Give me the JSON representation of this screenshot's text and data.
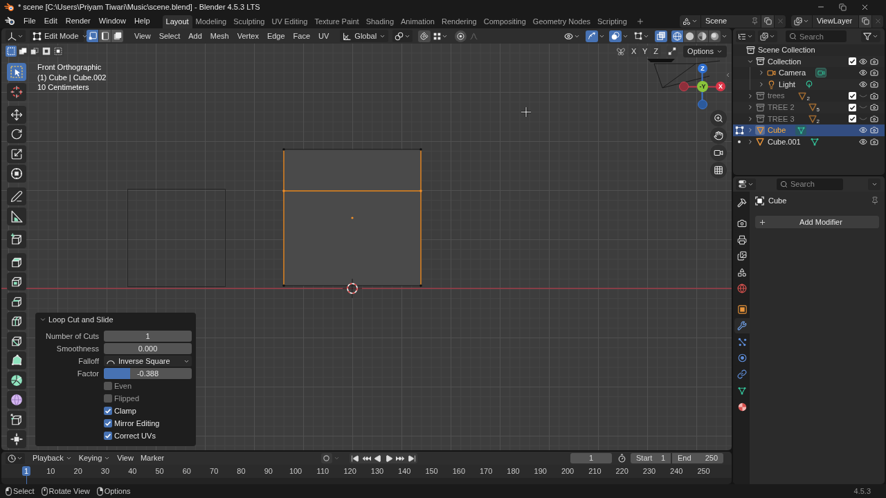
{
  "title_bar": {
    "title": "* scene [C:\\Users\\Priyam Tiwari\\Music\\scene.blend] - Blender 4.5.3 LTS"
  },
  "top_bar": {
    "menus": [
      "File",
      "Edit",
      "Render",
      "Window",
      "Help"
    ],
    "workspaces": [
      {
        "label": "Layout",
        "selected": true
      },
      {
        "label": "Modeling",
        "selected": false
      },
      {
        "label": "Sculpting",
        "selected": false
      },
      {
        "label": "UV Editing",
        "selected": false
      },
      {
        "label": "Texture Paint",
        "selected": false
      },
      {
        "label": "Shading",
        "selected": false
      },
      {
        "label": "Animation",
        "selected": false
      },
      {
        "label": "Rendering",
        "selected": false
      },
      {
        "label": "Compositing",
        "selected": false
      },
      {
        "label": "Geometry Nodes",
        "selected": false
      },
      {
        "label": "Scripting",
        "selected": false
      }
    ],
    "scene": "Scene",
    "view_layer": "ViewLayer"
  },
  "viewport": {
    "header": {
      "mode": "Edit Mode",
      "select_modes": [
        {
          "kind": "vertex",
          "selected": true
        },
        {
          "kind": "edge",
          "selected": false
        },
        {
          "kind": "face",
          "selected": false
        }
      ],
      "menus": [
        "View",
        "Select",
        "Add",
        "Mesh",
        "Vertex",
        "Edge",
        "Face",
        "UV"
      ],
      "orientation": "Global",
      "snapping": false,
      "proportional_editing": false,
      "gizmos": true,
      "overlays": true,
      "xray": true,
      "shading": [
        {
          "kind": "wireframe",
          "selected": true
        },
        {
          "kind": "solid",
          "selected": false
        },
        {
          "kind": "material",
          "selected": false
        },
        {
          "kind": "rendered",
          "selected": false
        }
      ]
    },
    "tool_settings": {
      "select_box_modes": [
        {
          "kind": "set",
          "selected": true
        },
        {
          "kind": "extend",
          "selected": false
        },
        {
          "kind": "subtract",
          "selected": false
        },
        {
          "kind": "invert",
          "selected": false
        },
        {
          "kind": "intersect",
          "selected": false
        }
      ],
      "mirror_axes": [
        {
          "label": "X",
          "selected": false
        },
        {
          "label": "Y",
          "selected": false
        },
        {
          "label": "Z",
          "selected": false
        }
      ],
      "options": "Options"
    },
    "info": [
      "Front Orthographic",
      "(1) Cube | Cube.002",
      "10 Centimeters"
    ],
    "toolbar": [
      {
        "tools": [
          {
            "kind": "select_box",
            "selected": true
          },
          {
            "kind": "cursor",
            "selected": false
          }
        ]
      },
      {
        "tools": [
          {
            "kind": "move",
            "selected": false
          },
          {
            "kind": "rotate",
            "selected": false
          },
          {
            "kind": "scale",
            "selected": false
          },
          {
            "kind": "transform",
            "selected": false
          }
        ]
      },
      {
        "tools": [
          {
            "kind": "annotate",
            "selected": false
          },
          {
            "kind": "measure",
            "selected": false
          }
        ]
      },
      {
        "tools": [
          {
            "kind": "add_cube",
            "selected": false
          }
        ]
      },
      {
        "tools": [
          {
            "kind": "extrude",
            "selected": false
          },
          {
            "kind": "inset",
            "selected": false
          },
          {
            "kind": "bevel",
            "selected": false
          },
          {
            "kind": "loop_cut",
            "selected": false
          },
          {
            "kind": "knife",
            "selected": false
          },
          {
            "kind": "poly_build",
            "selected": false
          },
          {
            "kind": "spin",
            "selected": false
          },
          {
            "kind": "smooth",
            "selected": false
          },
          {
            "kind": "edge_slide",
            "selected": false
          },
          {
            "kind": "shrink_fatten",
            "selected": false
          }
        ]
      }
    ],
    "gizmo": {
      "z": "Z",
      "y": "-Y",
      "x": "X"
    },
    "operator_panel": {
      "title": "Loop Cut and Slide",
      "expanded": true,
      "fields": [
        {
          "kind": "number",
          "label": "Number of Cuts",
          "value": "1"
        },
        {
          "kind": "number",
          "label": "Smoothness",
          "value": "0.000"
        },
        {
          "kind": "dropdown",
          "label": "Falloff",
          "value": "Inverse Square"
        },
        {
          "kind": "slider",
          "label": "Factor",
          "value": "-0.388",
          "level": 0.3
        }
      ],
      "checkboxes": [
        {
          "label": "Even",
          "checked": false
        },
        {
          "label": "Flipped",
          "checked": false
        },
        {
          "label": "Clamp",
          "checked": true
        },
        {
          "label": "Mirror Editing",
          "checked": true
        },
        {
          "label": "Correct UVs",
          "checked": true
        }
      ]
    }
  },
  "timeline": {
    "menus": [
      {
        "kind": "dropdown",
        "label": "Playback"
      },
      {
        "kind": "dropdown",
        "label": "Keying"
      },
      {
        "kind": "menu",
        "label": "View"
      },
      {
        "kind": "menu",
        "label": "Marker"
      }
    ],
    "auto_keying": false,
    "current_frame": "1",
    "start": {
      "label": "Start",
      "value": "1"
    },
    "end": {
      "label": "End",
      "value": "250"
    },
    "frames": [
      {
        "label": "1",
        "selected": true
      },
      {
        "label": "10",
        "selected": false
      },
      {
        "label": "20",
        "selected": false
      },
      {
        "label": "30",
        "selected": false
      },
      {
        "label": "40",
        "selected": false
      },
      {
        "label": "50",
        "selected": false
      },
      {
        "label": "60",
        "selected": false
      },
      {
        "label": "70",
        "selected": false
      },
      {
        "label": "80",
        "selected": false
      },
      {
        "label": "90",
        "selected": false
      },
      {
        "label": "100",
        "selected": false
      },
      {
        "label": "110",
        "selected": false
      },
      {
        "label": "120",
        "selected": false
      },
      {
        "label": "130",
        "selected": false
      },
      {
        "label": "140",
        "selected": false
      },
      {
        "label": "150",
        "selected": false
      },
      {
        "label": "160",
        "selected": false
      },
      {
        "label": "170",
        "selected": false
      },
      {
        "label": "180",
        "selected": false
      },
      {
        "label": "190",
        "selected": false
      },
      {
        "label": "200",
        "selected": false
      },
      {
        "label": "210",
        "selected": false
      },
      {
        "label": "220",
        "selected": false
      },
      {
        "label": "230",
        "selected": false
      },
      {
        "label": "240",
        "selected": false
      },
      {
        "label": "250",
        "selected": false
      }
    ]
  },
  "outliner": {
    "search_placeholder": "Search",
    "tree": [
      {
        "name": "Scene Collection",
        "kind": "scene_collection",
        "selected": false,
        "children": [
          {
            "name": "Collection",
            "kind": "collection",
            "expanded": true,
            "checked": true,
            "visible": true,
            "selected": false,
            "children": [
              {
                "name": "Camera",
                "kind": "camera",
                "expanded": false,
                "visible": true,
                "selected": false
              },
              {
                "name": "Light",
                "kind": "light",
                "expanded": false,
                "visible": true,
                "selected": false
              }
            ]
          },
          {
            "name": "trees",
            "kind": "collection",
            "expanded": false,
            "checked": true,
            "visible": false,
            "selected": false,
            "count": "2"
          },
          {
            "name": "TREE 2",
            "kind": "collection",
            "expanded": false,
            "checked": true,
            "visible": false,
            "selected": false,
            "count": "5"
          },
          {
            "name": "TREE 3",
            "kind": "collection",
            "expanded": false,
            "checked": true,
            "visible": false,
            "selected": false,
            "count": "2"
          },
          {
            "name": "Cube",
            "kind": "mesh",
            "expanded": false,
            "visible": true,
            "selected": true,
            "edit_mode": true
          },
          {
            "name": "Cube.001",
            "kind": "mesh",
            "expanded": false,
            "visible": true,
            "selected": false,
            "edit_mode": false
          }
        ]
      }
    ]
  },
  "properties": {
    "search_placeholder": "Search",
    "tab_groups": [
      {
        "tabs": [
          {
            "kind": "tool",
            "selected": false
          }
        ]
      },
      {
        "tabs": [
          {
            "kind": "render",
            "selected": false
          },
          {
            "kind": "output",
            "selected": false
          },
          {
            "kind": "view_layer",
            "selected": false
          },
          {
            "kind": "scene",
            "selected": false
          },
          {
            "kind": "world",
            "selected": false
          }
        ]
      },
      {
        "tabs": [
          {
            "kind": "object",
            "selected": false
          },
          {
            "kind": "modifiers",
            "selected": true
          },
          {
            "kind": "particles",
            "selected": false
          },
          {
            "kind": "physics",
            "selected": false
          },
          {
            "kind": "constraints",
            "selected": false
          },
          {
            "kind": "data",
            "selected": false
          },
          {
            "kind": "material",
            "selected": false
          }
        ]
      }
    ],
    "object_name": "Cube",
    "add_modifier": "Add Modifier"
  },
  "status_bar": {
    "items": [
      {
        "kind": "left_click",
        "label": "Select"
      },
      {
        "kind": "middle_click",
        "label": "Rotate View"
      },
      {
        "kind": "right_click",
        "label": "Options"
      }
    ],
    "version": "4.5.3"
  }
}
